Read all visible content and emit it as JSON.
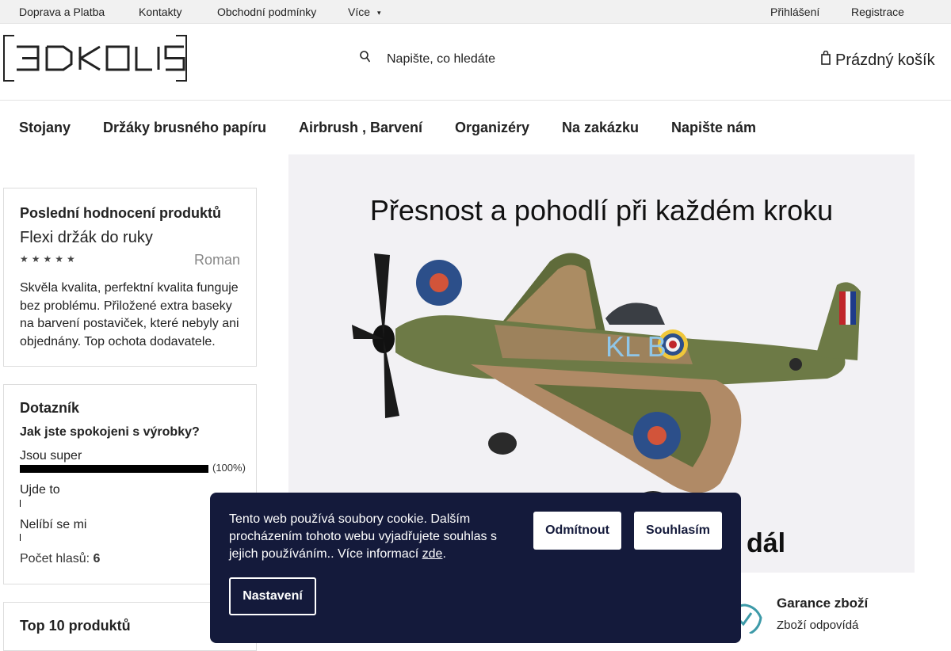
{
  "topbar": {
    "links": [
      "Doprava a Platba",
      "Kontakty",
      "Obchodní podmínky",
      "Více"
    ],
    "more_arrow": "▾",
    "login": "Přihlášení",
    "register": "Registrace"
  },
  "header": {
    "logo_text": "3DKOLIS",
    "search_placeholder": "Napište, co hledáte",
    "cart_label": "Prázdný košík"
  },
  "menu": {
    "items": [
      "Stojany",
      "Držáky brusného papíru",
      "Airbrush , Barvení",
      "Organizéry",
      "Na zakázku",
      "Napište nám"
    ]
  },
  "reviews": {
    "title": "Poslední hodnocení produktů",
    "product": "Flexi držák do ruky",
    "stars": "★★★★★",
    "author": "Roman",
    "text": "Skvěla kvalita, perfektní kvalita funguje bez problému. Přiložené extra baseky na barvení postaviček, které nebyly ani objednány. Top ochota dodavatele."
  },
  "poll": {
    "title": "Dotazník",
    "question": "Jak jste spokojeni s výrobky?",
    "options": [
      {
        "label": "Jsou super",
        "percent_text": "(100%)",
        "share": 1.0
      },
      {
        "label": "Ujde to",
        "share": 0
      },
      {
        "label": "Nelíbí se mi",
        "share": 0
      }
    ],
    "votes_label": "Počet hlasů:",
    "votes": "6"
  },
  "top10": {
    "title": "Top 10 produktů"
  },
  "banner": {
    "headline": "Přesnost a pohodlí při každém kroku",
    "tail": "dál",
    "plane_markings": "KL  B"
  },
  "guarantee": {
    "title": "Garance zboží",
    "text": "Zboží odpovídá"
  },
  "cookie": {
    "text": "Tento web používá soubory cookie. Dalším procházením tohoto webu vyjadřujete souhlas s jejich používáním.. Více informací ",
    "link": "zde",
    "after_link": ".",
    "decline": "Odmítnout",
    "accept": "Souhlasím",
    "settings": "Nastavení"
  },
  "colors": {
    "cookie_bg": "#141a3b",
    "accent_teal": "#3d9aa8"
  }
}
